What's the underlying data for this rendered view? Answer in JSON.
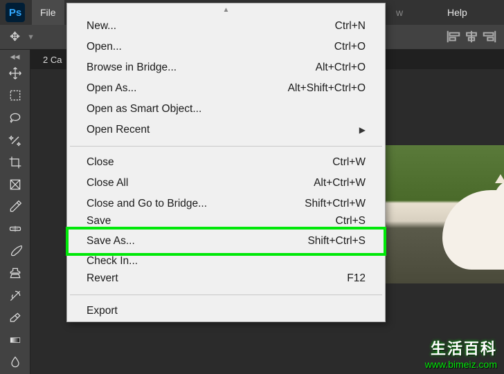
{
  "app": {
    "logo": "Ps"
  },
  "menubar": {
    "file": "File",
    "w": "w",
    "help": "Help"
  },
  "tab": {
    "label": "2 Ca"
  },
  "dropdown": {
    "new": "New...",
    "new_sc": "Ctrl+N",
    "open": "Open...",
    "open_sc": "Ctrl+O",
    "browse": "Browse in Bridge...",
    "browse_sc": "Alt+Ctrl+O",
    "openas": "Open As...",
    "openas_sc": "Alt+Shift+Ctrl+O",
    "opensmart": "Open as Smart Object...",
    "openrecent": "Open Recent",
    "close": "Close",
    "close_sc": "Ctrl+W",
    "closeall": "Close All",
    "closeall_sc": "Alt+Ctrl+W",
    "closebridge": "Close and Go to Bridge...",
    "closebridge_sc": "Shift+Ctrl+W",
    "save": "Save",
    "save_sc": "Ctrl+S",
    "saveas": "Save As...",
    "saveas_sc": "Shift+Ctrl+S",
    "checkin": "Check In...",
    "revert": "Revert",
    "revert_sc": "F12",
    "export": "Export"
  },
  "watermark": {
    "title": "生活百科",
    "url": "www.bimeiz.com"
  }
}
